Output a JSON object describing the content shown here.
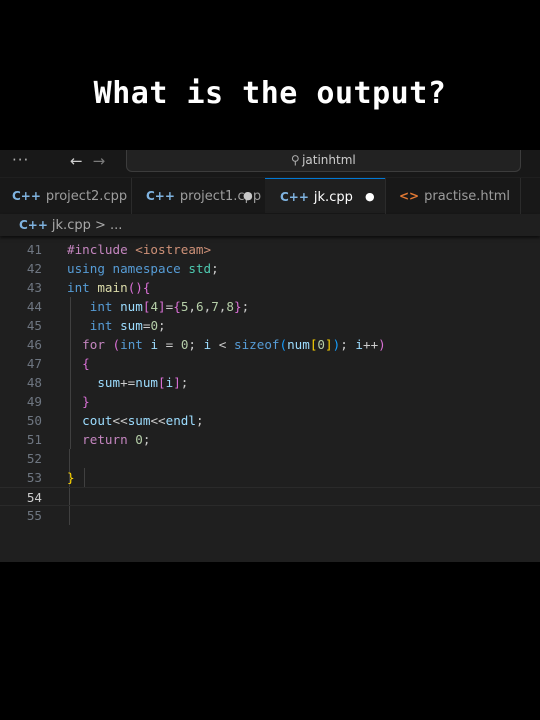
{
  "headline": "What is the output?",
  "titlebar": {
    "menu_dots": "···",
    "back_arrow": "←",
    "forward_arrow": "→",
    "search_text": "jatinhtml"
  },
  "tabs": [
    {
      "label": "project2.cpp",
      "icon": "C++",
      "modified": false
    },
    {
      "label": "project1.cpp",
      "icon": "C++",
      "modified": true
    },
    {
      "label": "jk.cpp",
      "icon": "C++",
      "modified": true,
      "active": true
    },
    {
      "label": "practise.html",
      "icon": "<>",
      "modified": false
    }
  ],
  "breadcrumb": {
    "file": "jk.cpp",
    "separator": ">",
    "more": "..."
  },
  "editor": {
    "current_line": 54,
    "line_numbers": [
      "41",
      "42",
      "43",
      "44",
      "45",
      "46",
      "47",
      "48",
      "49",
      "50",
      "51",
      "52",
      "53",
      "54",
      "55"
    ],
    "code_lines": [
      "#include <iostream>",
      "using namespace std;",
      "int main(){",
      "  int num[4]={5,6,7,8};",
      "  int sum=0;",
      "  for (int i = 0; i < sizeof(num[0]); i++)",
      "  {",
      "    sum+=num[i];",
      "  }",
      "  cout<<sum<<endl;",
      "  return 0;",
      "",
      "}",
      "",
      ""
    ]
  },
  "colors": {
    "editor_bg": "#1f1f1f",
    "keyword": "#569cd6",
    "control": "#c586c0",
    "string": "#ce9178",
    "number": "#b5cea8",
    "variable": "#9cdcfe",
    "function": "#dcdcaa",
    "type": "#4ec9b0",
    "active_tab_accent": "#0078d4"
  }
}
